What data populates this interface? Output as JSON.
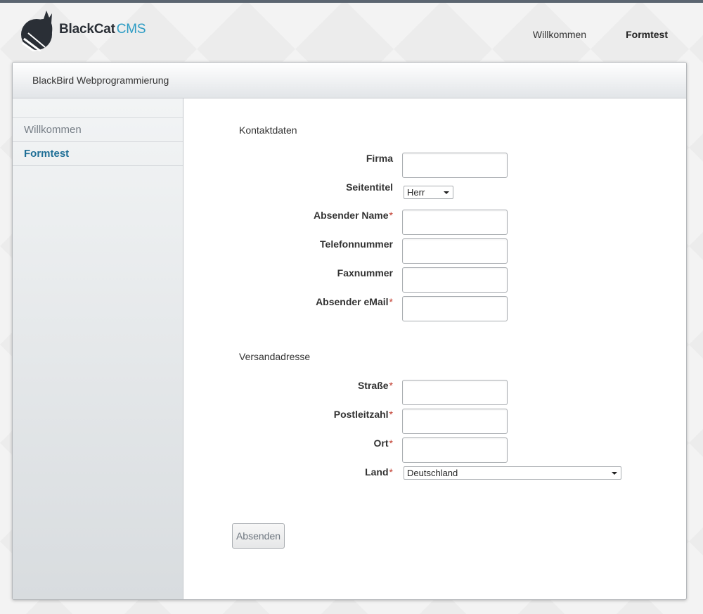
{
  "logo": {
    "brand": "BlackCat",
    "suffix": "CMS"
  },
  "topnav": {
    "items": [
      {
        "label": "Willkommen",
        "active": false
      },
      {
        "label": "Formtest",
        "active": true
      }
    ]
  },
  "panel": {
    "title": "BlackBird Webprogrammierung"
  },
  "sidebar": {
    "items": [
      {
        "label": "Willkommen",
        "active": false
      },
      {
        "label": "Formtest",
        "active": true
      }
    ]
  },
  "form": {
    "contact_title": "Kontaktdaten",
    "shipping_title": "Versandadresse",
    "required_mark": "*",
    "fields": {
      "firma": {
        "label": "Firma",
        "value": ""
      },
      "seitentitel": {
        "label": "Seitentitel",
        "value": "Herr"
      },
      "absender_name": {
        "label": "Absender Name",
        "value": ""
      },
      "telefon": {
        "label": "Telefonnummer",
        "value": ""
      },
      "fax": {
        "label": "Faxnummer",
        "value": ""
      },
      "email": {
        "label": "Absender eMail",
        "value": ""
      },
      "strasse": {
        "label": "Straße",
        "value": ""
      },
      "plz": {
        "label": "Postleitzahl",
        "value": ""
      },
      "ort": {
        "label": "Ort",
        "value": ""
      },
      "land": {
        "label": "Land",
        "value": "Deutschland"
      }
    },
    "submit_label": "Absenden"
  },
  "colors": {
    "accent": "#2c9cc4",
    "active_link": "#1f6f96",
    "required": "#c0392b",
    "topbar": "#5b6570"
  }
}
